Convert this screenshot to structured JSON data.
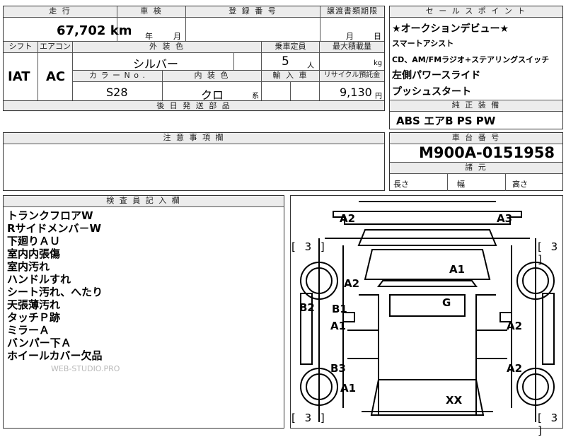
{
  "top_row": {
    "mileage_label": "走 行",
    "mileage": "67,702 km",
    "inspection_label": "車 検",
    "inspection_year": "年",
    "inspection_month": "月",
    "registration_label": "登 録 番 号",
    "transfer_label": "譲渡書類期限",
    "transfer_month": "月",
    "transfer_day": "日"
  },
  "second_row": {
    "shift_label": "シフト",
    "shift": "IAT",
    "ac_label": "エアコン",
    "ac": "AC",
    "exterior_label": "外 装 色",
    "exterior": "シルバー",
    "capacity_label": "乗車定員",
    "capacity": "5",
    "capacity_unit": "人",
    "max_load_label": "最大積載量",
    "max_load_unit": "kg",
    "color_no_label": "カ ラ ー  N o .",
    "color_no": "S28",
    "interior_label": "内 装 色",
    "interior": "クロ",
    "interior_suffix": "系",
    "import_label": "輸 入 車",
    "recycle_label": "リサイクル預託金",
    "recycle": "9,130",
    "recycle_unit": "円"
  },
  "delivery_label": "後 日 発 送 部 品",
  "caution_label": "注 意 事 項 欄",
  "sales_points": {
    "label": "セ ー ル ス ポ イ ン ト",
    "items": [
      "★オークションデビュー★",
      "スマートアシスト",
      "CD、AM/FMラジオ+ステアリングスイッチ",
      "左側パワースライド",
      "プッシュスタート"
    ]
  },
  "equipment": {
    "label": "純 正 装 備",
    "value": "ABS エアB PS PW"
  },
  "chassis": {
    "label": "車 台 番 号",
    "value": "M900A-0151958"
  },
  "dimensions": {
    "label": "諸 元",
    "length": "長さ",
    "width": "幅",
    "height": "高さ"
  },
  "inspector": {
    "label": "検 査 員 記 入 欄",
    "notes": [
      "トランクフロアW",
      "Rサイドメンバ－W",
      "下廻りＡＵ",
      "室内内張傷",
      "室内汚れ",
      "ハンドルすれ",
      "シート汚れ、へたり",
      "天張薄汚れ",
      "タッチＰ跡",
      "ミラーＡ",
      "バンパー下Ａ",
      "ホイールカバー欠品"
    ],
    "watermark": "WEB-STUDIO.PRO"
  },
  "diagram": {
    "brackets": [
      "[ 3 ]",
      "[ 3 ]",
      "[ 3 ]",
      "[ 3 ]"
    ],
    "marks": [
      "A2",
      "A3",
      "A1",
      "A2",
      "G",
      "B2",
      "B1",
      "A1",
      "A2",
      "B3",
      "A2",
      "A1",
      "XX"
    ]
  }
}
